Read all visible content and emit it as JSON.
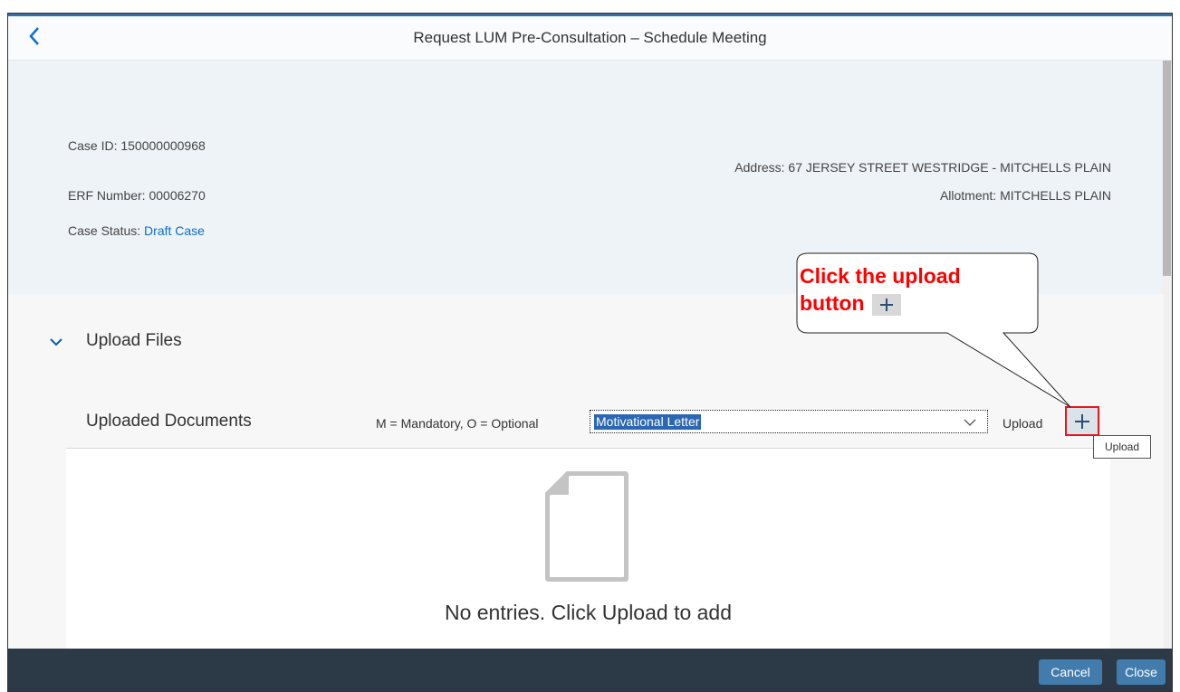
{
  "header": {
    "title": "Request LUM Pre-Consultation – Schedule Meeting"
  },
  "case_info": {
    "case_id": "Case ID: 150000000968",
    "erf_number": "ERF Number: 00006270",
    "case_status_label": "Case Status: ",
    "case_status_value": "Draft Case",
    "address": "Address: 67 JERSEY STREET WESTRIDGE - MITCHELLS PLAIN",
    "allotment": "Allotment: MITCHELLS PLAIN"
  },
  "upload_section": {
    "title": "Upload Files",
    "documents_title": "Uploaded Documents",
    "legend": "M = Mandatory, O = Optional",
    "selected_document": "Motivational Letter",
    "upload_label": "Upload",
    "upload_tooltip": "Upload",
    "empty_text": "No entries. Click Upload to add"
  },
  "callout": {
    "line1": "Click the upload",
    "line2": "button"
  },
  "footer": {
    "cancel_label": "Cancel",
    "close_label": "Close"
  },
  "colors": {
    "accent": "#0a6ed1",
    "footer_bg": "#2c3a47",
    "button_bg": "#427cac",
    "highlight": "#e8171f"
  }
}
